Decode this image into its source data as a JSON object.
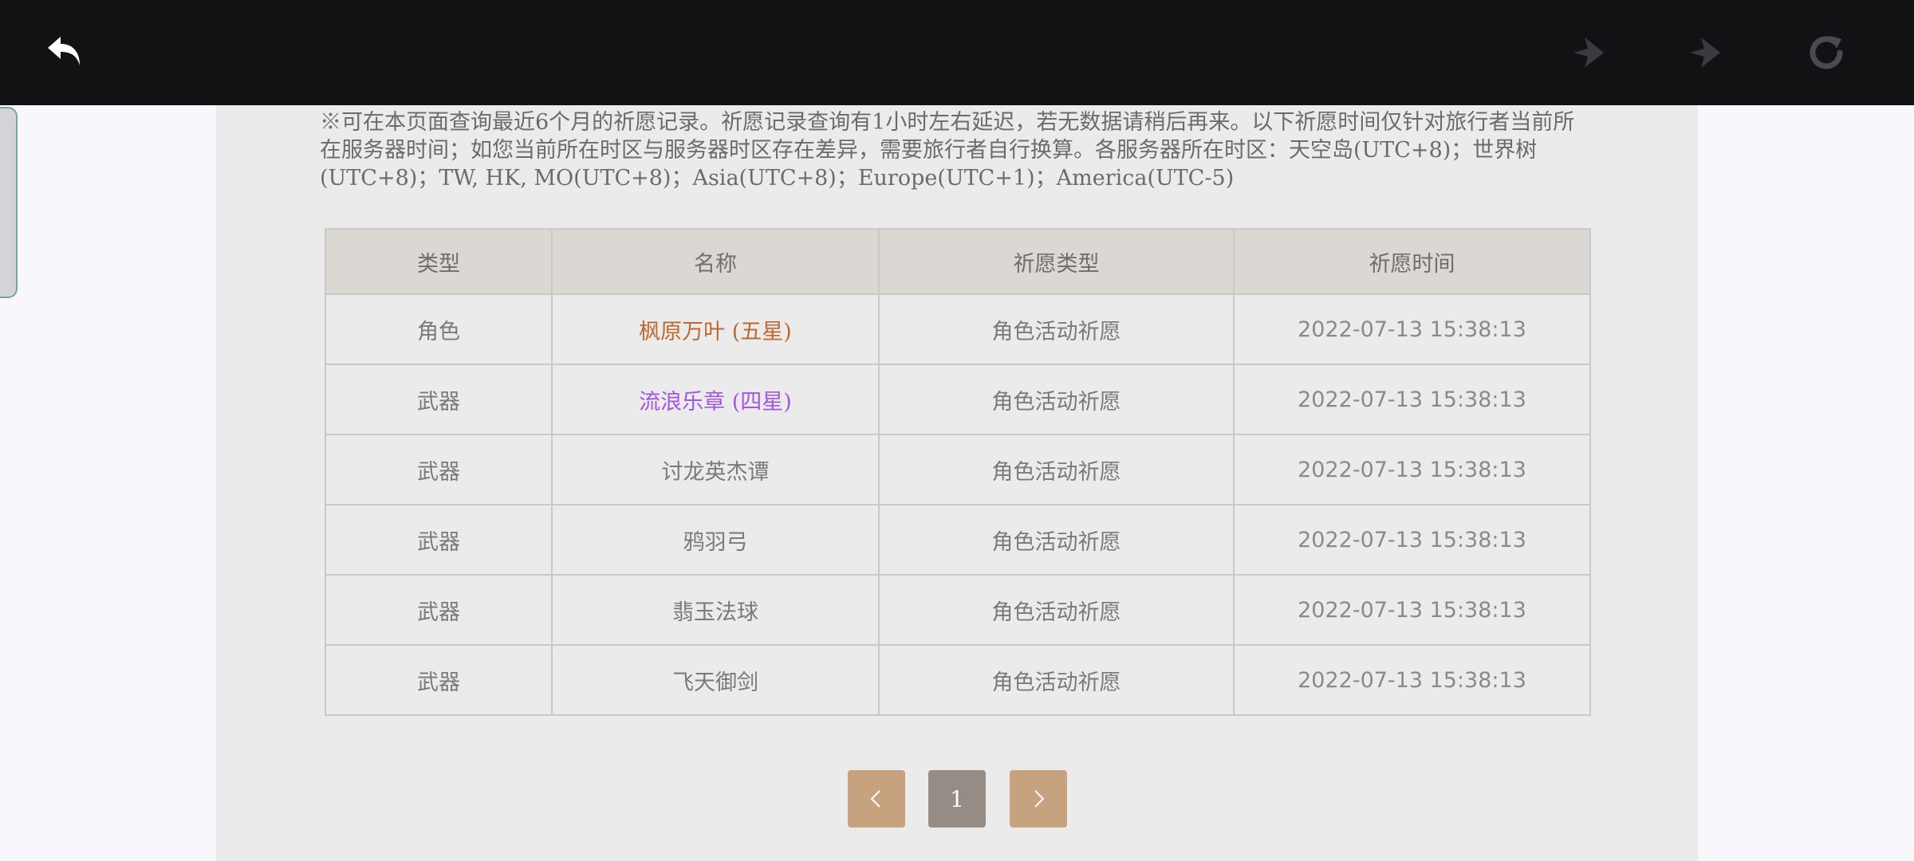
{
  "toolbar": {
    "icons": [
      "back-icon",
      "forward-dim-icon",
      "forward-dim-icon",
      "reload-icon"
    ],
    "colors": {
      "background": "#111214",
      "active": "#ffffff",
      "inactive": "#3a3b3f"
    }
  },
  "notice": "※可在本页面查询最近6个月的祈愿记录。祈愿记录查询有1小时左右延迟，若无数据请稍后再来。以下祈愿时间仅针对旅行者当前所在服务器时间；如您当前所在时区与服务器时区存在差异，需要旅行者自行换算。各服务器所在时区：天空岛(UTC+8)；世界树(UTC+8)；TW, HK, MO(UTC+8)；Asia(UTC+8)；Europe(UTC+1)；America(UTC-5)",
  "table": {
    "headers": [
      "类型",
      "名称",
      "祈愿类型",
      "祈愿时间"
    ],
    "rows": [
      {
        "type": "角色",
        "name": "枫原万叶 (五星)",
        "wish": "角色活动祈愿",
        "time": "2022-07-13 15:38:13"
      },
      {
        "type": "武器",
        "name": "流浪乐章 (四星)",
        "wish": "角色活动祈愿",
        "time": "2022-07-13 15:38:13"
      },
      {
        "type": "武器",
        "name": "讨龙英杰谭",
        "wish": "角色活动祈愿",
        "time": "2022-07-13 15:38:13"
      },
      {
        "type": "武器",
        "name": "鸦羽弓",
        "wish": "角色活动祈愿",
        "time": "2022-07-13 15:38:13"
      },
      {
        "type": "武器",
        "name": "翡玉法球",
        "wish": "角色活动祈愿",
        "time": "2022-07-13 15:38:13"
      },
      {
        "type": "武器",
        "name": "飞天御剑",
        "wish": "角色活动祈愿",
        "time": "2022-07-13 15:38:13"
      }
    ],
    "rarity_colors": {
      "five_star": "#bd6932",
      "four_star": "#a256e1"
    }
  },
  "pagination": {
    "current_page": "1",
    "prev_icon": "chevron-left-icon",
    "next_icon": "chevron-right-icon"
  }
}
